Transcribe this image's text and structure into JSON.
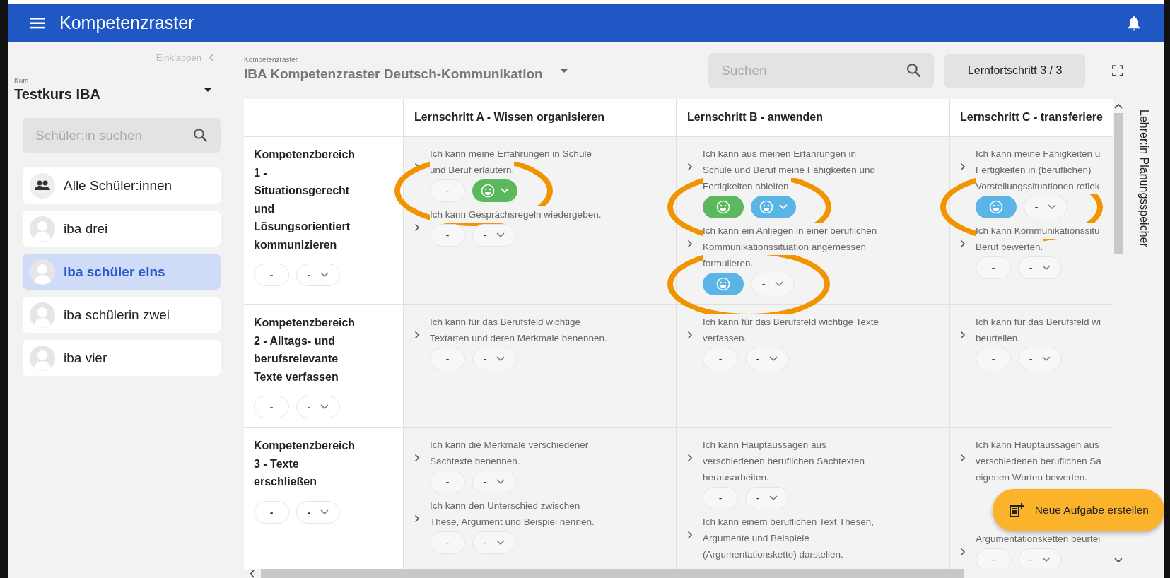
{
  "app_bar": {
    "title": "Kompetenzraster"
  },
  "sidebar": {
    "collapse": "Einklappen",
    "course_label": "Kurs",
    "course": "Testkurs IBA",
    "search": {
      "placeholder": "Schüler:in suchen"
    },
    "items": [
      {
        "kind": "group",
        "label": "Alle Schüler:innen",
        "selected": false
      },
      {
        "kind": "person",
        "label": "iba drei",
        "selected": false
      },
      {
        "kind": "person",
        "label": "iba schüler eins",
        "selected": true
      },
      {
        "kind": "person",
        "label": "iba schülerin zwei",
        "selected": false
      },
      {
        "kind": "person",
        "label": "iba vier",
        "selected": false
      }
    ]
  },
  "header": {
    "breadcrumb": "Kompetenzraster",
    "title": "IBA Kompetenzraster Deutsch-Kommunikation",
    "search": {
      "placeholder": "Suchen"
    },
    "progress_button": "Lernfortschritt 3 / 3"
  },
  "table": {
    "columns": [
      "Lernschritt A - Wissen organisieren",
      "Lernschritt B - anwenden",
      "Lernschritt C - transferiere"
    ],
    "rows": [
      {
        "lines": [
          "Kompetenzbereich",
          "1 -",
          "Situationsgerecht",
          "und",
          "Lösungsorientiert",
          "kommunizieren"
        ],
        "pills": [
          {
            "kind": "dash",
            "text": "-"
          },
          {
            "kind": "select",
            "text": "-"
          }
        ],
        "cells": [
          [
            {
              "lines": [
                "Ich kann meine Erfahrungen in Schule",
                "und Beruf erläutern."
              ],
              "circled": true,
              "pills": [
                {
                  "kind": "dash",
                  "text": "-"
                },
                {
                  "kind": "smiley_select",
                  "color": "#5cb85c"
                }
              ]
            },
            {
              "lines": [
                "Ich kann Gesprächsregeln wiedergeben."
              ],
              "circled": false,
              "pills": [
                {
                  "kind": "dash",
                  "text": "-"
                },
                {
                  "kind": "select",
                  "text": "-"
                }
              ]
            }
          ],
          [
            {
              "lines": [
                "Ich kann aus meinen Erfahrungen in",
                "Schule und Beruf meine Fähigkeiten und",
                "Fertigkeiten ableiten."
              ],
              "circled": true,
              "pills": [
                {
                  "kind": "smiley",
                  "color": "#5cb85c"
                },
                {
                  "kind": "smiley_select",
                  "color": "#5ab4e5"
                }
              ]
            },
            {
              "lines": [
                "Ich kann ein Anliegen in einer beruflichen",
                "Kommunikationssituation angemessen",
                "formulieren."
              ],
              "circled": true,
              "pills": [
                {
                  "kind": "smiley",
                  "color": "#5ab4e5"
                },
                {
                  "kind": "select",
                  "text": "-"
                }
              ]
            }
          ],
          [
            {
              "lines": [
                "Ich kann meine Fähigkeiten u",
                "Fertigkeiten in (beruflichen)",
                "Vorstellungssituationen reflek"
              ],
              "circled": true,
              "pills": [
                {
                  "kind": "smiley",
                  "color": "#5ab4e5"
                },
                {
                  "kind": "select",
                  "text": "-"
                }
              ]
            },
            {
              "lines": [
                "Ich kann Kommunikationssitu",
                "Beruf bewerten."
              ],
              "circled": false,
              "pills": [
                {
                  "kind": "dash",
                  "text": "-"
                },
                {
                  "kind": "select",
                  "text": "-"
                }
              ]
            }
          ]
        ]
      },
      {
        "lines": [
          "Kompetenzbereich",
          "2 - Alltags- und",
          "berufsrelevante",
          "Texte verfassen"
        ],
        "pills": [
          {
            "kind": "dash",
            "text": "-"
          },
          {
            "kind": "select",
            "text": "-"
          }
        ],
        "cells": [
          [
            {
              "lines": [
                "Ich kann für das Berufsfeld wichtige",
                "Textarten und deren Merkmale benennen."
              ],
              "circled": false,
              "pills": [
                {
                  "kind": "dash",
                  "text": "-"
                },
                {
                  "kind": "select",
                  "text": "-"
                }
              ]
            }
          ],
          [
            {
              "lines": [
                "Ich kann für das Berufsfeld wichtige Texte",
                "verfassen."
              ],
              "circled": false,
              "pills": [
                {
                  "kind": "dash",
                  "text": "-"
                },
                {
                  "kind": "select",
                  "text": "-"
                }
              ]
            }
          ],
          [
            {
              "lines": [
                "Ich kann für das Berufsfeld wi",
                "beurteilen."
              ],
              "circled": false,
              "pills": [
                {
                  "kind": "dash",
                  "text": "-"
                },
                {
                  "kind": "select",
                  "text": "-"
                }
              ]
            }
          ]
        ]
      },
      {
        "lines": [
          "Kompetenzbereich",
          "3 - Texte",
          "erschließen"
        ],
        "pills": [
          {
            "kind": "dash",
            "text": "-"
          },
          {
            "kind": "select",
            "text": "-"
          }
        ],
        "cells": [
          [
            {
              "lines": [
                "Ich kann die Merkmale verschiedener",
                "Sachtexte benennen."
              ],
              "circled": false,
              "pills": [
                {
                  "kind": "dash",
                  "text": "-"
                },
                {
                  "kind": "select",
                  "text": "-"
                }
              ]
            },
            {
              "lines": [
                "Ich kann den Unterschied zwischen",
                "These, Argument und Beispiel nennen."
              ],
              "circled": false,
              "pills": [
                {
                  "kind": "dash",
                  "text": "-"
                },
                {
                  "kind": "select",
                  "text": "-"
                }
              ]
            }
          ],
          [
            {
              "lines": [
                "Ich kann Hauptaussagen aus",
                "verschiedenen beruflichen Sachtexten",
                "herausarbeiten."
              ],
              "circled": false,
              "pills": [
                {
                  "kind": "dash",
                  "text": "-"
                },
                {
                  "kind": "select",
                  "text": "-"
                }
              ]
            },
            {
              "lines": [
                "Ich kann einem beruflichen Text Thesen,",
                "Argumente und Beispiele",
                "(Argumentationskette) darstellen."
              ],
              "circled": false
            }
          ],
          [
            {
              "lines": [
                "Ich kann Hauptaussagen aus",
                "verschiedenen beruflichen Sa",
                "eigenen Worten bewerten."
              ],
              "circled": false
            },
            {
              "lines": [
                "Argumentationsketten beurtei"
              ],
              "circled": false,
              "pills": [
                {
                  "kind": "dash",
                  "text": "-"
                },
                {
                  "kind": "select",
                  "text": "-"
                }
              ]
            }
          ]
        ]
      }
    ]
  },
  "side_panel": {
    "label": "Lehrer:in Planungsspeicher"
  },
  "fab": {
    "label": "Neue Aufgabe erstellen"
  }
}
